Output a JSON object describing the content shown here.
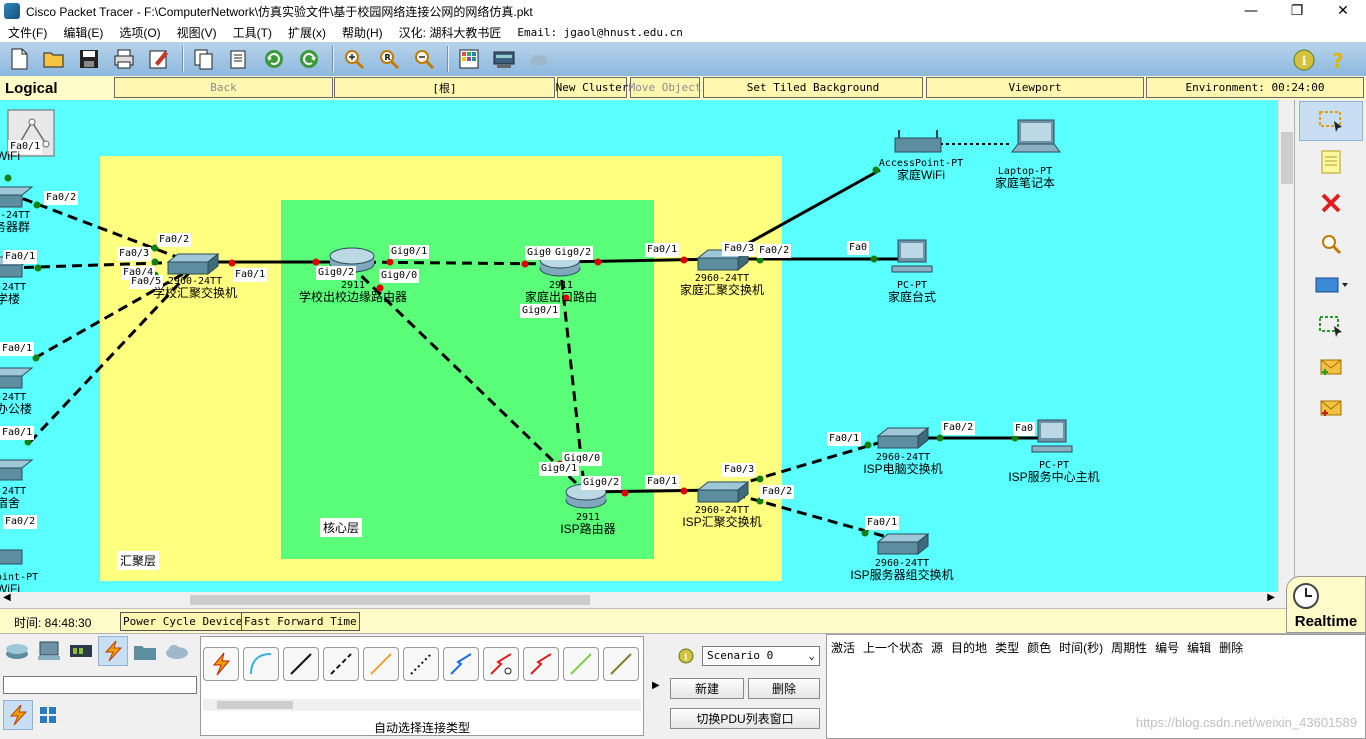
{
  "window": {
    "title": "Cisco Packet Tracer - F:\\ComputerNetwork\\仿真实验文件\\基于校园网络连接公网的网络仿真.pkt",
    "controls": [
      "—",
      "❐",
      "✕"
    ]
  },
  "menu": [
    "文件(F)",
    "编辑(E)",
    "选项(O)",
    "视图(V)",
    "工具(T)",
    "扩展(x)",
    "帮助(H)",
    "汉化: 湖科大教书匠",
    "Email: jgaol@hnust.edu.cn"
  ],
  "navbar": {
    "tab": "Logical",
    "back": "Back",
    "root": "[根]",
    "new_cluster": "New Cluster",
    "move_object": "Move Object",
    "set_tiled_background": "Set Tiled Background",
    "viewport": "Viewport",
    "environment": "Environment: 00:24:00"
  },
  "areas": {
    "aggregation": "汇聚层",
    "core": "核心层"
  },
  "devices": {
    "school_switch": {
      "model": "2960-24TT",
      "name": "学校汇聚交换机"
    },
    "school_router": {
      "model": "2911",
      "name": "学校出校边缘路由器"
    },
    "home_router": {
      "model": "2911",
      "name": "家庭出口路由"
    },
    "home_switch": {
      "model": "2960-24TT",
      "name": "家庭汇聚交换机"
    },
    "home_ap": {
      "model": "AccessPoint-PT",
      "name": "家庭WiFi"
    },
    "home_laptop": {
      "model": "Laptop-PT",
      "name": "家庭笔记本"
    },
    "home_pc": {
      "model": "PC-PT",
      "name": "家庭台式"
    },
    "isp_router": {
      "model": "2911",
      "name": "ISP路由器"
    },
    "isp_switch": {
      "model": "2960-24TT",
      "name": "ISP汇聚交换机"
    },
    "isp_pc_switch": {
      "model": "2960-24TT",
      "name": "ISP电脑交换机"
    },
    "isp_host": {
      "model": "PC-PT",
      "name": "ISP服务中心主机"
    },
    "isp_server_switch": {
      "model": "2960-24TT",
      "name": "ISP服务器组交换机"
    },
    "left_server_switch": {
      "model": "0-24TT",
      "name": "务器群"
    },
    "left_teach_switch": {
      "model": "-24TT",
      "name": "学楼"
    },
    "left_office_switch": {
      "model": "-24TT",
      "name": "办公楼"
    },
    "left_dorm_switch": {
      "model": "-24TT",
      "name": "宿舍"
    },
    "left_ap_top": {
      "model": "",
      "name": "WiFi"
    },
    "left_ap_bottom": {
      "model": "oint-PT",
      "name": "WiFi"
    }
  },
  "ports": {
    "p_fa0_2_a": "Fa0/2",
    "p_fa0_1_a": "Fa0/1",
    "p_fa0_1_b": "Fa0/1",
    "p_fa0_1_c": "Fa0/1",
    "p_fa0_2_b": "Fa0/2",
    "p_fa0_1_top": "Fa0/1",
    "p_fa0_3": "Fa0/3",
    "p_fa0_2_c": "Fa0/2",
    "p_fa0_4": "Fa0/4",
    "p_fa0_5": "Fa0/5",
    "p_fa0_1_d": "Fa0/1",
    "p_gig0_2_a": "Gig0/2",
    "p_gig0_1_a": "Gig0/1",
    "p_gig0_0_a": "Gig0/0",
    "p_gig0_b": "Gig0",
    "p_gig0_2_b": "Gig0/2",
    "p_gig0_1_b": "Gig0/1",
    "p_fa0_1_e": "Fa0/1",
    "p_fa0_3_b": "Fa0/3",
    "p_fa0_2_d": "Fa0/2",
    "p_fa0": "Fa0",
    "p_gig0_0_c": "Gig0/0",
    "p_gig0_1_c": "Gig0/1",
    "p_gig0_2_c": "Gig0/2",
    "p_fa0_1_f": "Fa0/1",
    "p_fa0_3_c": "Fa0/3",
    "p_fa0_2_e": "Fa0/2",
    "p_fa0_1_g": "Fa0/1",
    "p_fa0_2_f": "Fa0/2",
    "p_fa0_b": "Fa0",
    "p_fa0_1_h": "Fa0/1"
  },
  "status": {
    "time": "时间: 84:48:30",
    "power_cycle": "Power Cycle Devices",
    "fast_forward": "Fast Forward Time",
    "realtime": "Realtime"
  },
  "connections": {
    "label": "自动选择连接类型"
  },
  "pdu": {
    "scenario": "Scenario 0",
    "new": "新建",
    "delete": "删除",
    "toggle": "切换PDU列表窗口",
    "columns": [
      "激活",
      "上一个状态",
      "源",
      "目的地",
      "类型",
      "颜色",
      "时间(秒)",
      "周期性",
      "编号",
      "编辑",
      "删除"
    ]
  },
  "watermark": "https://blog.csdn.net/weixin_43601589",
  "colors": {
    "workspace": "#5affff",
    "aggregation_area": "#ffff80",
    "core_area": "#5afe78",
    "link_up": "#108010",
    "link_down": "#e00000"
  }
}
